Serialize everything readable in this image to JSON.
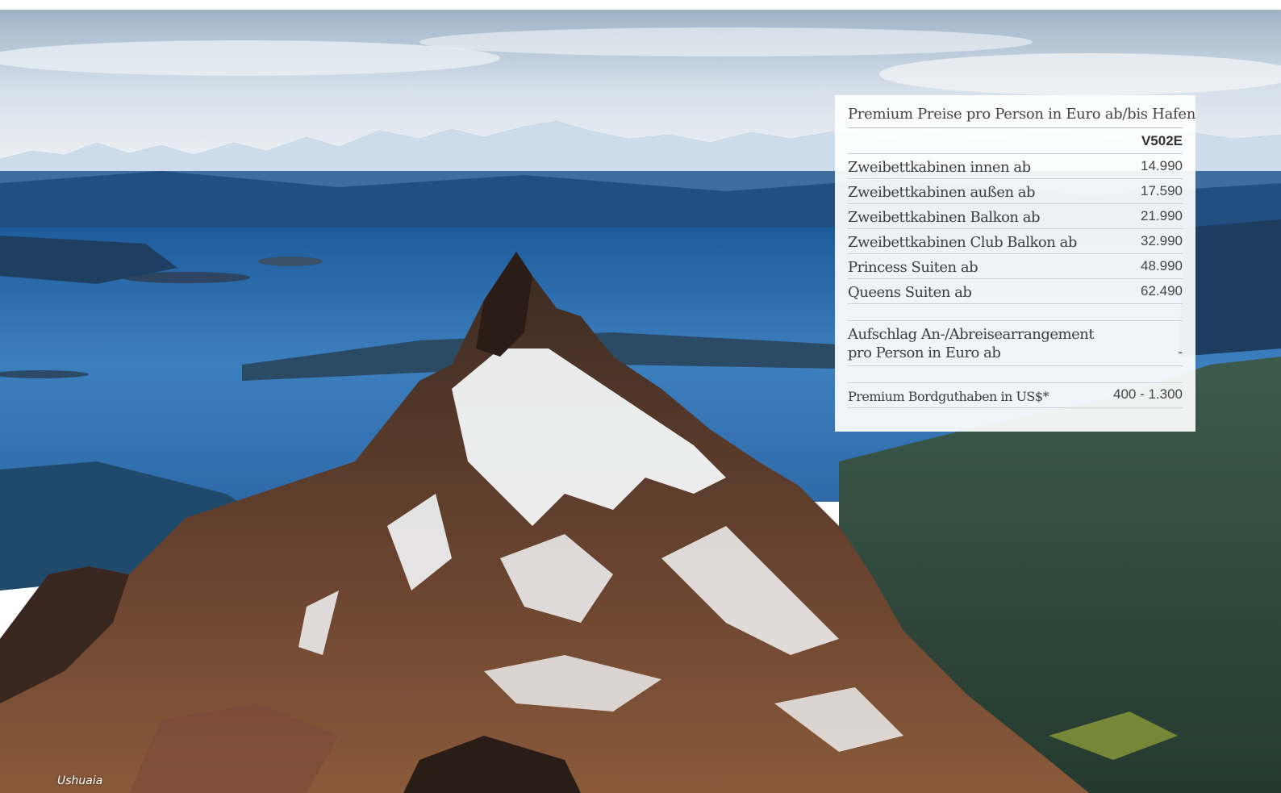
{
  "photo": {
    "caption": "Ushuaia"
  },
  "price_panel": {
    "title": "Premium Preise pro Person in Euro ab/bis Hafen",
    "code": "V502E",
    "rows": [
      {
        "label": "Zweibettkabinen innen ab",
        "value": "14.990"
      },
      {
        "label": "Zweibettkabinen außen ab",
        "value": "17.590"
      },
      {
        "label": "Zweibettkabinen Balkon ab",
        "value": "21.990"
      },
      {
        "label": "Zweibettkabinen Club Balkon ab",
        "value": "32.990"
      },
      {
        "label": "Princess Suiten ab",
        "value": "48.990"
      },
      {
        "label": "Queens Suiten ab",
        "value": "62.490"
      }
    ],
    "surcharge": {
      "label_line1": "Aufschlag An-/Abreisearrangement",
      "label_line2": "pro Person in Euro ab",
      "value": "-"
    },
    "credit": {
      "label": "Premium Bordguthaben in US$*",
      "value": "400 - 1.300"
    }
  },
  "colors": {
    "sky": "#dfe8f0",
    "water": "#2f6aa6",
    "snow": "#f4f6f8",
    "rock": "#5a3a28",
    "forest": "#2f4a3c"
  }
}
